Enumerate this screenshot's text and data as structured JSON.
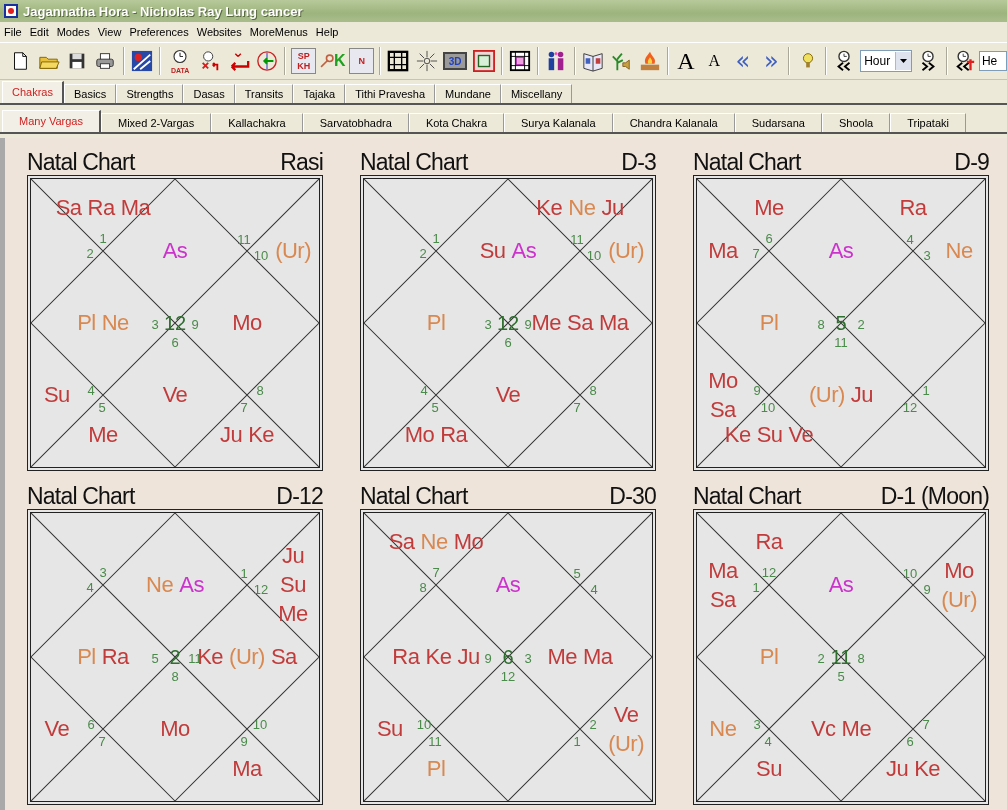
{
  "window": {
    "title": "Jagannatha Hora - Nicholas Ray Lung cancer"
  },
  "menu": [
    "File",
    "Edit",
    "Modes",
    "View",
    "Preferences",
    "Websites",
    "MoreMenus",
    "Help"
  ],
  "toolbar": [
    {
      "kind": "icon"
    },
    {
      "kind": "icon"
    },
    {
      "kind": "icon"
    },
    {
      "kind": "icon"
    },
    {
      "kind": "separator"
    },
    {
      "kind": "icon"
    },
    {
      "kind": "separator"
    },
    {
      "kind": "icon",
      "label": "DATA"
    },
    {
      "kind": "icon"
    },
    {
      "kind": "icon"
    },
    {
      "kind": "icon"
    },
    {
      "kind": "separator"
    },
    {
      "kind": "icon",
      "label": "SP KH"
    },
    {
      "kind": "icon",
      "label": "K"
    },
    {
      "kind": "icon",
      "label": "N"
    },
    {
      "kind": "separator"
    },
    {
      "kind": "icon"
    },
    {
      "kind": "icon"
    },
    {
      "kind": "icon",
      "label": "3D"
    },
    {
      "kind": "icon"
    },
    {
      "kind": "separator"
    },
    {
      "kind": "icon"
    },
    {
      "kind": "separator"
    },
    {
      "kind": "icon"
    },
    {
      "kind": "separator"
    },
    {
      "kind": "icon"
    },
    {
      "kind": "icon"
    },
    {
      "kind": "icon"
    },
    {
      "kind": "separator"
    },
    {
      "kind": "glyph",
      "label": "A",
      "large": true
    },
    {
      "kind": "glyph",
      "label": "A",
      "large": false
    },
    {
      "kind": "arrow",
      "label": "«"
    },
    {
      "kind": "arrow",
      "label": "»"
    },
    {
      "kind": "separator"
    },
    {
      "kind": "icon"
    },
    {
      "kind": "separator"
    },
    {
      "kind": "icon"
    },
    {
      "kind": "dropdown",
      "value": "Hour"
    },
    {
      "kind": "icon"
    },
    {
      "kind": "separator"
    },
    {
      "kind": "icon"
    },
    {
      "kind": "field",
      "value": "He"
    }
  ],
  "tabs": [
    {
      "label": "Chakras",
      "selected": true
    },
    {
      "label": "Basics",
      "selected": false
    },
    {
      "label": "Strengths",
      "selected": false
    },
    {
      "label": "Dasas",
      "selected": false
    },
    {
      "label": "Transits",
      "selected": false
    },
    {
      "label": "Tajaka",
      "selected": false
    },
    {
      "label": "Tithi Pravesha",
      "selected": false
    },
    {
      "label": "Mundane",
      "selected": false
    },
    {
      "label": "Miscellany",
      "selected": false
    }
  ],
  "subtabs": [
    {
      "label": "Many Vargas",
      "selected": true
    },
    {
      "label": "Mixed 2-Vargas",
      "selected": false
    },
    {
      "label": "Kallachakra",
      "selected": false
    },
    {
      "label": "Sarvatobhadra",
      "selected": false
    },
    {
      "label": "Kota Chakra",
      "selected": false
    },
    {
      "label": "Surya Kalanala",
      "selected": false
    },
    {
      "label": "Chandra Kalanala",
      "selected": false
    },
    {
      "label": "Sudarsana",
      "selected": false
    },
    {
      "label": "Shoola",
      "selected": false
    },
    {
      "label": "Tripataki",
      "selected": false
    }
  ],
  "charts": [
    {
      "title": "Natal Chart",
      "varga": "Rasi",
      "signs": [
        {
          "kind": "top-left",
          "sign": "1"
        },
        {
          "kind": "top-right",
          "sign": "11"
        },
        {
          "kind": "left-top",
          "sign": "2"
        },
        {
          "kind": "right-top",
          "sign": "10"
        },
        {
          "kind": "left",
          "sign": "3"
        },
        {
          "kind": "top",
          "sign": "12"
        },
        {
          "kind": "right",
          "sign": "9"
        },
        {
          "kind": "bottom",
          "sign": "6"
        },
        {
          "kind": "left-bottom",
          "sign": "4"
        },
        {
          "kind": "right-bottom",
          "sign": "8"
        },
        {
          "kind": "bottom-left",
          "sign": "5"
        },
        {
          "kind": "bottom-right",
          "sign": "7"
        }
      ],
      "planets": [
        {
          "name": "Sa",
          "color": "#c23b3b",
          "kind": "top-left"
        },
        {
          "name": "Ra",
          "color": "#c23b3b",
          "kind": "top-left"
        },
        {
          "name": "Ma",
          "color": "#c23b3b",
          "kind": "top-left"
        },
        {
          "name": "As",
          "color": "#cc33cc",
          "kind": "top"
        },
        {
          "name": "(Ur)",
          "color": "#d98850",
          "kind": "right-top"
        },
        {
          "name": "Pl",
          "color": "#d98850",
          "kind": "left"
        },
        {
          "name": "Ne",
          "color": "#d98850",
          "kind": "left"
        },
        {
          "name": "Mo",
          "color": "#c23b3b",
          "kind": "right"
        },
        {
          "name": "Su",
          "color": "#c23b3b",
          "kind": "left-bottom"
        },
        {
          "name": "Ve",
          "color": "#c23b3b",
          "kind": "bottom"
        },
        {
          "name": "Me",
          "color": "#c23b3b",
          "kind": "bottom-left"
        },
        {
          "name": "Ju",
          "color": "#c23b3b",
          "kind": "bottom-right"
        },
        {
          "name": "Ke",
          "color": "#c23b3b",
          "kind": "bottom-right"
        }
      ]
    },
    {
      "title": "Natal Chart",
      "varga": "D-3",
      "signs": [
        {
          "kind": "top-left",
          "sign": "1"
        },
        {
          "kind": "top-right",
          "sign": "11"
        },
        {
          "kind": "left-top",
          "sign": "2"
        },
        {
          "kind": "right-top",
          "sign": "10"
        },
        {
          "kind": "left",
          "sign": "3"
        },
        {
          "kind": "top",
          "sign": "12"
        },
        {
          "kind": "right",
          "sign": "9"
        },
        {
          "kind": "bottom",
          "sign": "6"
        },
        {
          "kind": "left-bottom",
          "sign": "4"
        },
        {
          "kind": "right-bottom",
          "sign": "8"
        },
        {
          "kind": "bottom-left",
          "sign": "5"
        },
        {
          "kind": "bottom-right",
          "sign": "7"
        }
      ],
      "planets": [
        {
          "name": "Ke",
          "color": "#c23b3b",
          "kind": "top-right"
        },
        {
          "name": "Ne",
          "color": "#d98850",
          "kind": "top-right"
        },
        {
          "name": "Ju",
          "color": "#c23b3b",
          "kind": "top-right"
        },
        {
          "name": "Su",
          "color": "#c23b3b",
          "kind": "top"
        },
        {
          "name": "As",
          "color": "#cc33cc",
          "kind": "top"
        },
        {
          "name": "(Ur)",
          "color": "#d98850",
          "kind": "right-top"
        },
        {
          "name": "Pl",
          "color": "#d98850",
          "kind": "left"
        },
        {
          "name": "Me",
          "color": "#c23b3b",
          "kind": "right"
        },
        {
          "name": "Sa",
          "color": "#c23b3b",
          "kind": "right"
        },
        {
          "name": "Ma",
          "color": "#c23b3b",
          "kind": "right"
        },
        {
          "name": "Ve",
          "color": "#c23b3b",
          "kind": "bottom"
        },
        {
          "name": "Mo",
          "color": "#c23b3b",
          "kind": "bottom-left"
        },
        {
          "name": "Ra",
          "color": "#c23b3b",
          "kind": "bottom-left"
        }
      ]
    },
    {
      "title": "Natal Chart",
      "varga": "D-9",
      "signs": [
        {
          "kind": "top-left",
          "sign": "6"
        },
        {
          "kind": "top-right",
          "sign": "4"
        },
        {
          "kind": "left-top",
          "sign": "7"
        },
        {
          "kind": "right-top",
          "sign": "3"
        },
        {
          "kind": "left",
          "sign": "8"
        },
        {
          "kind": "top",
          "sign": "5"
        },
        {
          "kind": "right",
          "sign": "2"
        },
        {
          "kind": "bottom",
          "sign": "11"
        },
        {
          "kind": "left-bottom",
          "sign": "9"
        },
        {
          "kind": "right-bottom",
          "sign": "1"
        },
        {
          "kind": "bottom-left",
          "sign": "10"
        },
        {
          "kind": "bottom-right",
          "sign": "12"
        }
      ],
      "planets": [
        {
          "name": "Me",
          "color": "#c23b3b",
          "kind": "top-left"
        },
        {
          "name": "Ra",
          "color": "#c23b3b",
          "kind": "top-right"
        },
        {
          "name": "Ma",
          "color": "#c23b3b",
          "kind": "left-top"
        },
        {
          "name": "As",
          "color": "#cc33cc",
          "kind": "top"
        },
        {
          "name": "Ne",
          "color": "#d98850",
          "kind": "right-top"
        },
        {
          "name": "Pl",
          "color": "#d98850",
          "kind": "left"
        },
        {
          "name": "Mo",
          "color": "#c23b3b",
          "kind": "left-bottom"
        },
        {
          "name": "Sa",
          "color": "#c23b3b",
          "kind": "left-bottom"
        },
        {
          "name": "(Ur)",
          "color": "#d98850",
          "kind": "bottom"
        },
        {
          "name": "Ju",
          "color": "#c23b3b",
          "kind": "bottom"
        },
        {
          "name": "Ke",
          "color": "#c23b3b",
          "kind": "bottom-left"
        },
        {
          "name": "Su",
          "color": "#c23b3b",
          "kind": "bottom-left"
        },
        {
          "name": "Ve",
          "color": "#c23b3b",
          "kind": "bottom-left"
        }
      ]
    },
    {
      "title": "Natal Chart",
      "varga": "D-12",
      "signs": [
        {
          "kind": "top-left",
          "sign": "3"
        },
        {
          "kind": "top-right",
          "sign": "1"
        },
        {
          "kind": "left-top",
          "sign": "4"
        },
        {
          "kind": "right-top",
          "sign": "12"
        },
        {
          "kind": "left",
          "sign": "5"
        },
        {
          "kind": "top",
          "sign": "2"
        },
        {
          "kind": "right",
          "sign": "11"
        },
        {
          "kind": "bottom",
          "sign": "8"
        },
        {
          "kind": "left-bottom",
          "sign": "6"
        },
        {
          "kind": "right-bottom",
          "sign": "10"
        },
        {
          "kind": "bottom-left",
          "sign": "7"
        },
        {
          "kind": "bottom-right",
          "sign": "9"
        }
      ],
      "planets": [
        {
          "name": "Ju",
          "color": "#c23b3b",
          "kind": "right-top"
        },
        {
          "name": "Ne",
          "color": "#d98850",
          "kind": "top"
        },
        {
          "name": "As",
          "color": "#cc33cc",
          "kind": "top"
        },
        {
          "name": "Su",
          "color": "#c23b3b",
          "kind": "right-top"
        },
        {
          "name": "Me",
          "color": "#c23b3b",
          "kind": "right-top"
        },
        {
          "name": "Pl",
          "color": "#d98850",
          "kind": "left"
        },
        {
          "name": "Ra",
          "color": "#c23b3b",
          "kind": "left"
        },
        {
          "name": "Ke",
          "color": "#c23b3b",
          "kind": "right"
        },
        {
          "name": "(Ur)",
          "color": "#d98850",
          "kind": "right"
        },
        {
          "name": "Sa",
          "color": "#c23b3b",
          "kind": "right"
        },
        {
          "name": "Ve",
          "color": "#c23b3b",
          "kind": "left-bottom"
        },
        {
          "name": "Mo",
          "color": "#c23b3b",
          "kind": "bottom"
        },
        {
          "name": "Ma",
          "color": "#c23b3b",
          "kind": "bottom-right"
        }
      ]
    },
    {
      "title": "Natal Chart",
      "varga": "D-30",
      "signs": [
        {
          "kind": "top-left",
          "sign": "7"
        },
        {
          "kind": "top-right",
          "sign": "5"
        },
        {
          "kind": "left-top",
          "sign": "8"
        },
        {
          "kind": "right-top",
          "sign": "4"
        },
        {
          "kind": "left",
          "sign": "9"
        },
        {
          "kind": "top",
          "sign": "6"
        },
        {
          "kind": "right",
          "sign": "3"
        },
        {
          "kind": "bottom",
          "sign": "12"
        },
        {
          "kind": "left-bottom",
          "sign": "10"
        },
        {
          "kind": "right-bottom",
          "sign": "2"
        },
        {
          "kind": "bottom-left",
          "sign": "11"
        },
        {
          "kind": "bottom-right",
          "sign": "1"
        }
      ],
      "planets": [
        {
          "name": "Sa",
          "color": "#c23b3b",
          "kind": "top-left"
        },
        {
          "name": "Ne",
          "color": "#d98850",
          "kind": "top-left"
        },
        {
          "name": "Mo",
          "color": "#c23b3b",
          "kind": "top-left"
        },
        {
          "name": "As",
          "color": "#cc33cc",
          "kind": "top"
        },
        {
          "name": "Ra",
          "color": "#c23b3b",
          "kind": "left"
        },
        {
          "name": "Ke",
          "color": "#c23b3b",
          "kind": "left"
        },
        {
          "name": "Ju",
          "color": "#c23b3b",
          "kind": "left"
        },
        {
          "name": "Me",
          "color": "#c23b3b",
          "kind": "right"
        },
        {
          "name": "Ma",
          "color": "#c23b3b",
          "kind": "right"
        },
        {
          "name": "Su",
          "color": "#c23b3b",
          "kind": "left-bottom"
        },
        {
          "name": "Ve",
          "color": "#c23b3b",
          "kind": "right-bottom"
        },
        {
          "name": "(Ur)",
          "color": "#d98850",
          "kind": "right-bottom"
        },
        {
          "name": "Pl",
          "color": "#d98850",
          "kind": "bottom-left"
        }
      ]
    },
    {
      "title": "Natal Chart",
      "varga": "D-1 (Moon)",
      "signs": [
        {
          "kind": "top-left",
          "sign": "12"
        },
        {
          "kind": "top-right",
          "sign": "10"
        },
        {
          "kind": "left-top",
          "sign": "1"
        },
        {
          "kind": "right-top",
          "sign": "9"
        },
        {
          "kind": "left",
          "sign": "2"
        },
        {
          "kind": "top",
          "sign": "11"
        },
        {
          "kind": "right",
          "sign": "8"
        },
        {
          "kind": "bottom",
          "sign": "5"
        },
        {
          "kind": "left-bottom",
          "sign": "3"
        },
        {
          "kind": "right-bottom",
          "sign": "7"
        },
        {
          "kind": "bottom-left",
          "sign": "4"
        },
        {
          "kind": "bottom-right",
          "sign": "6"
        }
      ],
      "planets": [
        {
          "name": "Ra",
          "color": "#c23b3b",
          "kind": "top-left"
        },
        {
          "name": "Ma",
          "color": "#c23b3b",
          "kind": "left-top"
        },
        {
          "name": "As",
          "color": "#cc33cc",
          "kind": "top"
        },
        {
          "name": "Mo",
          "color": "#c23b3b",
          "kind": "right-top"
        },
        {
          "name": "Sa",
          "color": "#c23b3b",
          "kind": "left-top"
        },
        {
          "name": "(Ur)",
          "color": "#d98850",
          "kind": "right-top"
        },
        {
          "name": "Pl",
          "color": "#d98850",
          "kind": "left"
        },
        {
          "name": "Ne",
          "color": "#d98850",
          "kind": "left-bottom"
        },
        {
          "name": "Vc",
          "color": "#c23b3b",
          "kind": "bottom"
        },
        {
          "name": "Me",
          "color": "#c23b3b",
          "kind": "bottom"
        },
        {
          "name": "Su",
          "color": "#c23b3b",
          "kind": "bottom-left"
        },
        {
          "name": "Ju",
          "color": "#c23b3b",
          "kind": "bottom-right"
        },
        {
          "name": "Ke",
          "color": "#c23b3b",
          "kind": "bottom-right"
        }
      ]
    }
  ]
}
